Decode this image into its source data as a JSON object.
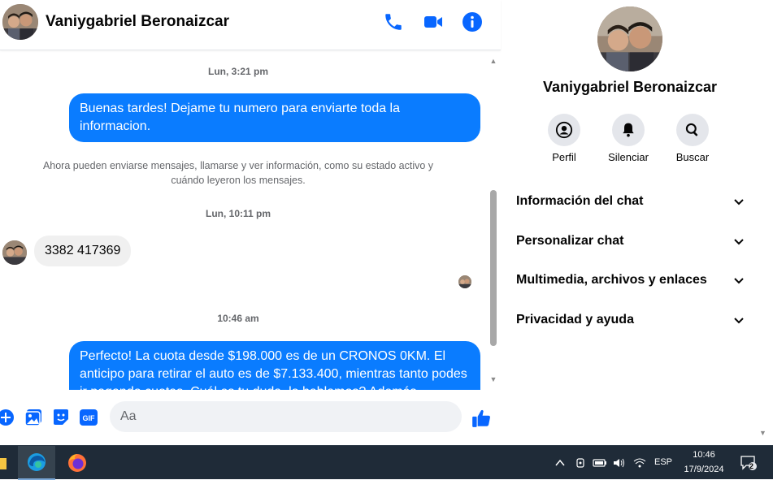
{
  "header": {
    "contact_name": "Vaniygabriel Beronaizcar",
    "icons": [
      "phone-icon",
      "video-camera-icon",
      "info-icon"
    ]
  },
  "messages": [
    {
      "type": "timestamp",
      "text": "Lun, 3:21 pm"
    },
    {
      "type": "outgoing",
      "text": "Buenas tardes! Dejame tu numero para enviarte toda la informacion."
    },
    {
      "type": "system",
      "text": "Ahora pueden enviarse mensajes, llamarse y ver información, como su estado activo y cuándo leyeron los mensajes."
    },
    {
      "type": "timestamp",
      "text": "Lun, 10:11 pm"
    },
    {
      "type": "incoming",
      "text": "3382 417369"
    },
    {
      "type": "timestamp",
      "text": "10:46 am"
    },
    {
      "type": "outgoing",
      "text": "Perfecto! La cuota desde $198.000 es de un CRONOS 0KM. El anticipo para retirar el auto es de $7.133.400, mientras tanto podes ir pagando cuotas. Cuál es tu duda, lo hablamos? Además"
    }
  ],
  "composer": {
    "placeholder": "Aa",
    "icons": [
      "plus-icon",
      "image-icon",
      "sticker-icon",
      "gif-icon",
      "emoji-icon",
      "like-icon"
    ],
    "gif_label": "GIF"
  },
  "side": {
    "name": "Vaniygabriel Beronaizcar",
    "actions": [
      {
        "label": "Perfil",
        "icon": "profile-icon"
      },
      {
        "label": "Silenciar",
        "icon": "bell-icon"
      },
      {
        "label": "Buscar",
        "icon": "search-icon"
      }
    ],
    "sections": [
      {
        "label": "Información del chat"
      },
      {
        "label": "Personalizar chat"
      },
      {
        "label": "Multimedia, archivos y enlaces"
      },
      {
        "label": "Privacidad y ayuda"
      }
    ]
  },
  "taskbar": {
    "language": "ESP",
    "time": "10:46",
    "date": "17/9/2024",
    "notifications": "2"
  },
  "colors": {
    "accent": "#0a7cff",
    "icon_blue": "#0866ff",
    "taskbar": "#1f2b38"
  }
}
